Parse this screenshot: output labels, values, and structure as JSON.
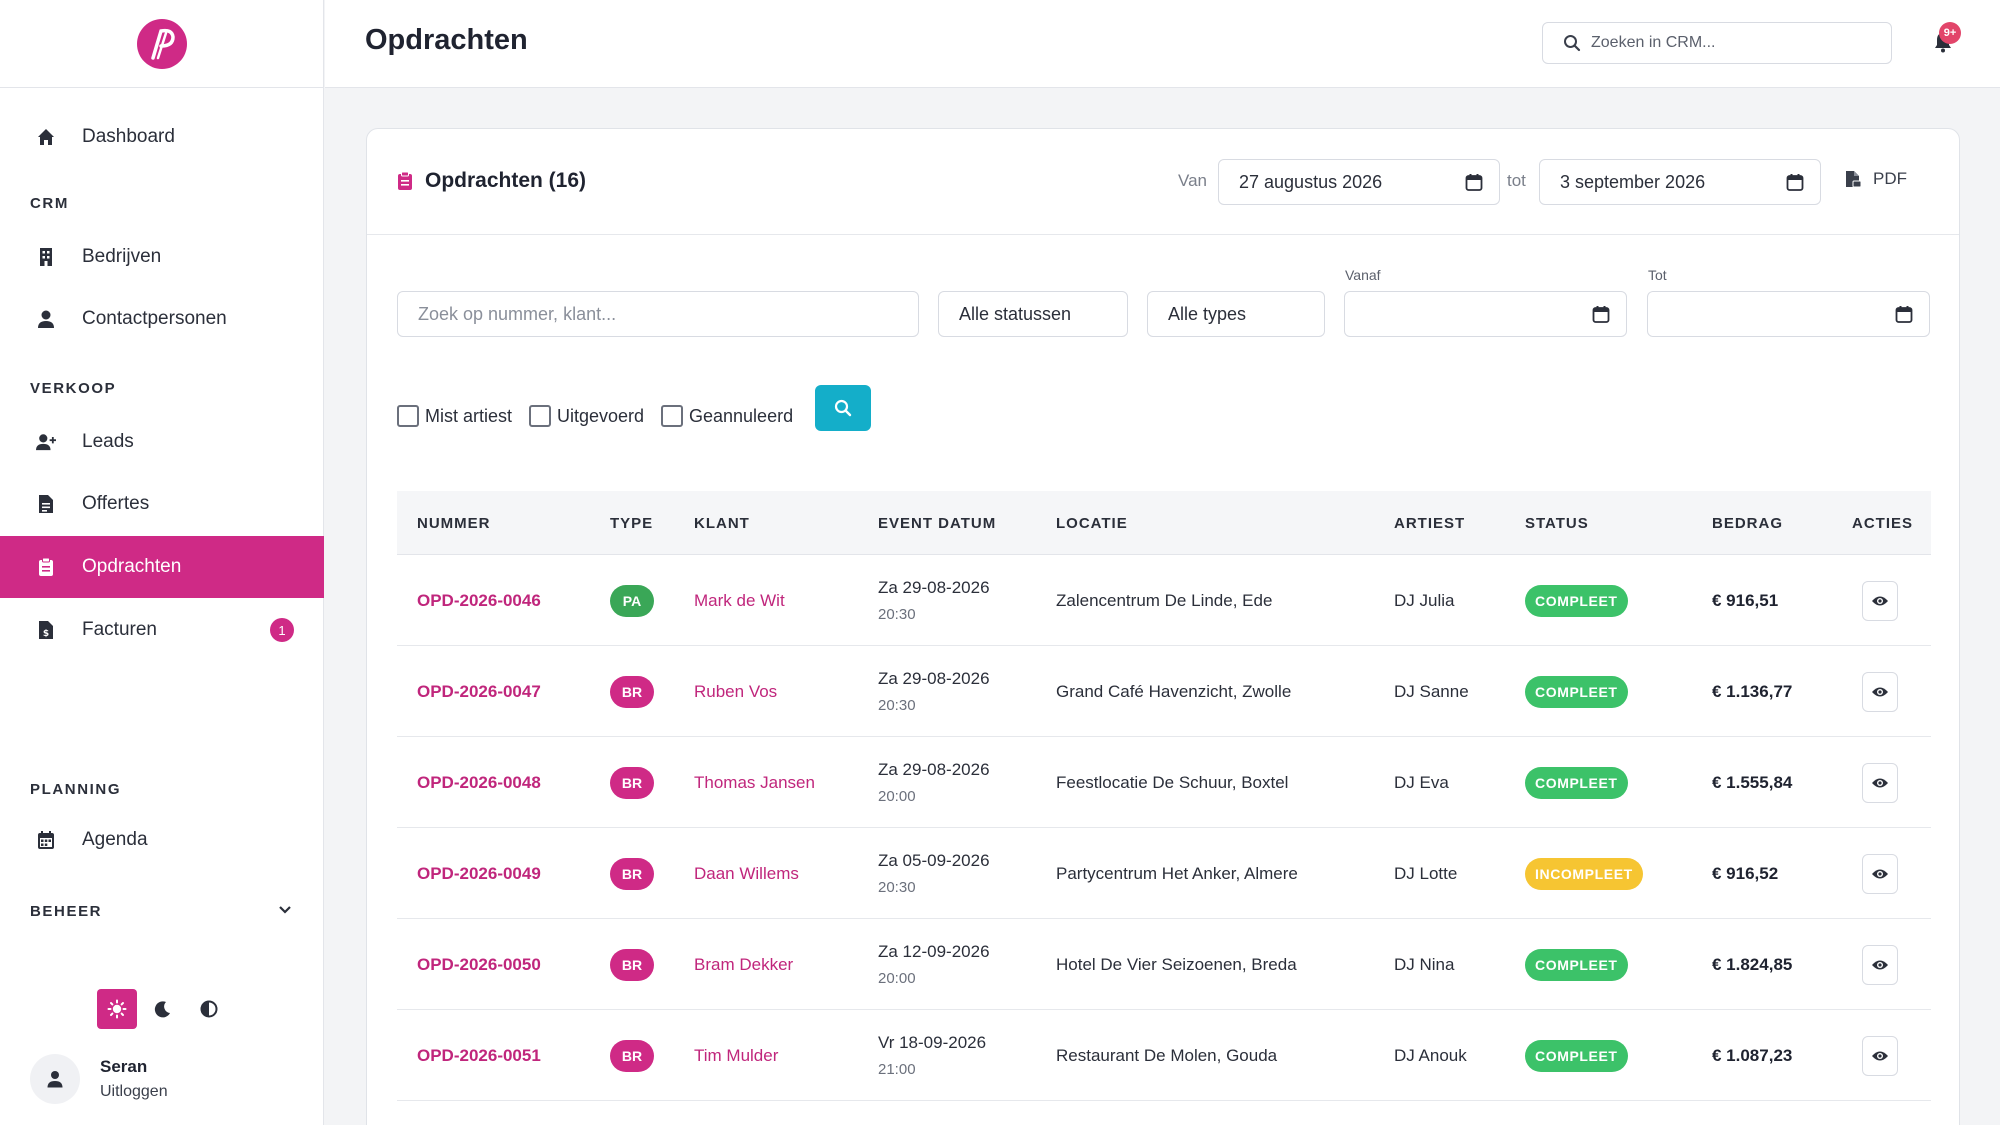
{
  "sidebar": {
    "items": {
      "dashboard": "Dashboard",
      "bedrijven": "Bedrijven",
      "contactpersonen": "Contactpersonen",
      "leads": "Leads",
      "offertes": "Offertes",
      "opdrachten": "Opdrachten",
      "facturen": "Facturen",
      "agenda": "Agenda"
    },
    "sections": {
      "crm": "CRM",
      "verkoop": "VERKOOP",
      "planning": "PLANNING",
      "beheer": "BEHEER"
    },
    "facturen_badge": "1",
    "user": {
      "name": "Seran",
      "logout": "Uitloggen"
    }
  },
  "topbar": {
    "title": "Opdrachten",
    "search_placeholder": "Zoeken in CRM...",
    "notification_badge": "9+"
  },
  "card": {
    "title": "Opdrachten (16)",
    "van_label": "Van",
    "van_value": "27 augustus 2026",
    "tot_label": "tot",
    "tot_value": "3 september 2026",
    "pdf_label": "PDF"
  },
  "filters": {
    "search_placeholder": "Zoek op nummer, klant...",
    "status_value": "Alle statussen",
    "type_value": "Alle types",
    "vanaf_label": "Vanaf",
    "tot_label": "Tot",
    "checks": {
      "mist_artiest": "Mist artiest",
      "uitgevoerd": "Uitgevoerd",
      "geannuleerd": "Geannuleerd"
    }
  },
  "table": {
    "headers": {
      "nummer": "NUMMER",
      "type": "TYPE",
      "klant": "KLANT",
      "datum": "EVENT DATUM",
      "locatie": "LOCATIE",
      "artiest": "ARTIEST",
      "status": "STATUS",
      "bedrag": "BEDRAG",
      "acties": "ACTIES"
    },
    "rows": [
      {
        "nummer": "OPD-2026-0046",
        "type": "PA",
        "klant": "Mark de Wit",
        "datum": "Za 29-08-2026",
        "tijd": "20:30",
        "locatie": "Zalencentrum De Linde, Ede",
        "artiest": "DJ Julia",
        "status": "COMPLEET",
        "bedrag": "€ 916,51"
      },
      {
        "nummer": "OPD-2026-0047",
        "type": "BR",
        "klant": "Ruben Vos",
        "datum": "Za 29-08-2026",
        "tijd": "20:30",
        "locatie": "Grand Café Havenzicht, Zwolle",
        "artiest": "DJ Sanne",
        "status": "COMPLEET",
        "bedrag": "€ 1.136,77"
      },
      {
        "nummer": "OPD-2026-0048",
        "type": "BR",
        "klant": "Thomas Jansen",
        "datum": "Za 29-08-2026",
        "tijd": "20:00",
        "locatie": "Feestlocatie De Schuur, Boxtel",
        "artiest": "DJ Eva",
        "status": "COMPLEET",
        "bedrag": "€ 1.555,84"
      },
      {
        "nummer": "OPD-2026-0049",
        "type": "BR",
        "klant": "Daan Willems",
        "datum": "Za 05-09-2026",
        "tijd": "20:30",
        "locatie": "Partycentrum Het Anker, Almere",
        "artiest": "DJ Lotte",
        "status": "INCOMPLEET",
        "bedrag": "€ 916,52"
      },
      {
        "nummer": "OPD-2026-0050",
        "type": "BR",
        "klant": "Bram Dekker",
        "datum": "Za 12-09-2026",
        "tijd": "20:00",
        "locatie": "Hotel De Vier Seizoenen, Breda",
        "artiest": "DJ Nina",
        "status": "COMPLEET",
        "bedrag": "€ 1.824,85"
      },
      {
        "nummer": "OPD-2026-0051",
        "type": "BR",
        "klant": "Tim Mulder",
        "datum": "Vr 18-09-2026",
        "tijd": "21:00",
        "locatie": "Restaurant De Molen, Gouda",
        "artiest": "DJ Anouk",
        "status": "COMPLEET",
        "bedrag": "€ 1.087,23"
      }
    ]
  },
  "colors": {
    "accent": "#cf2a86",
    "search_button": "#14aec9",
    "status_ok": "#3cc269",
    "status_incomplete": "#f6c532",
    "type_pa": "#3aa757"
  }
}
